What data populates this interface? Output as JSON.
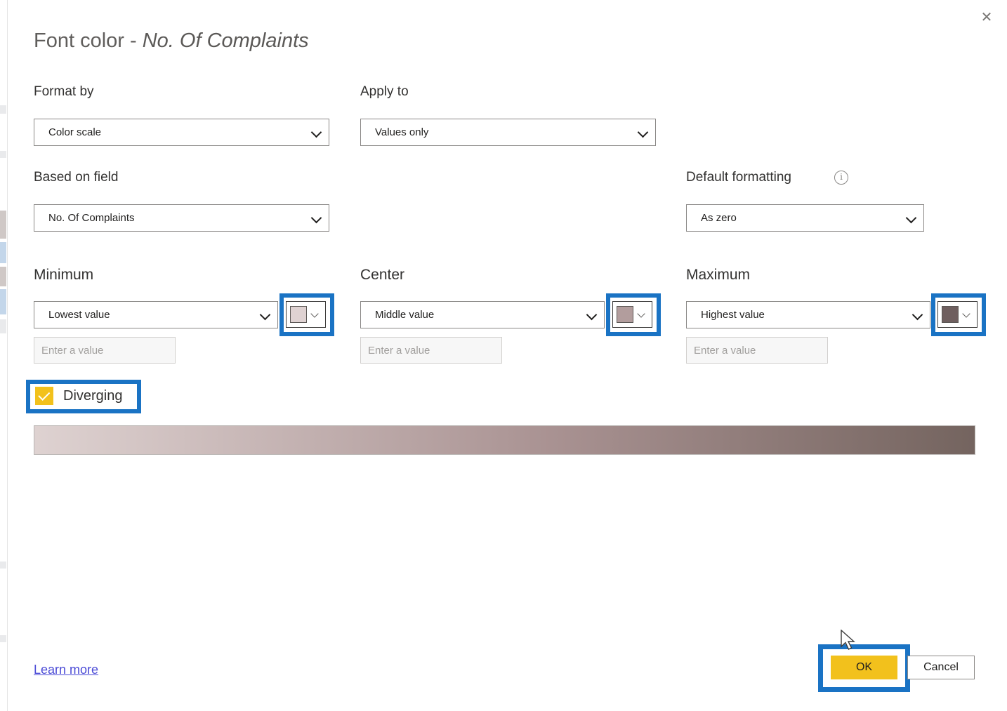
{
  "dialog": {
    "title_prefix": "Font color - ",
    "title_field": "No. Of Complaints",
    "close_label": "✕"
  },
  "format_by": {
    "label": "Format by",
    "value": "Color scale"
  },
  "apply_to": {
    "label": "Apply to",
    "value": "Values only"
  },
  "based_on_field": {
    "label": "Based on field",
    "value": "No. Of Complaints"
  },
  "default_formatting": {
    "label": "Default formatting",
    "info_glyph": "i",
    "value": "As zero"
  },
  "minimum": {
    "label": "Minimum",
    "value": "Lowest value",
    "input_placeholder": "Enter a value",
    "color": "#dfd2d2"
  },
  "center": {
    "label": "Center",
    "value": "Middle value",
    "input_placeholder": "Enter a value",
    "color": "#b29d9d"
  },
  "maximum": {
    "label": "Maximum",
    "value": "Highest value",
    "input_placeholder": "Enter a value",
    "color": "#6f5f5f"
  },
  "diverging": {
    "label": "Diverging",
    "checked": true,
    "checkbox_fill": "#f2c11c"
  },
  "gradient_preview": {
    "start_color": "#ded2d1",
    "mid_color": "#a99292",
    "end_color": "#74645f"
  },
  "footer": {
    "learn_more": "Learn more",
    "ok_label": "OK",
    "cancel_label": "Cancel"
  },
  "annotation": {
    "highlight_color": "#1a73c4"
  }
}
